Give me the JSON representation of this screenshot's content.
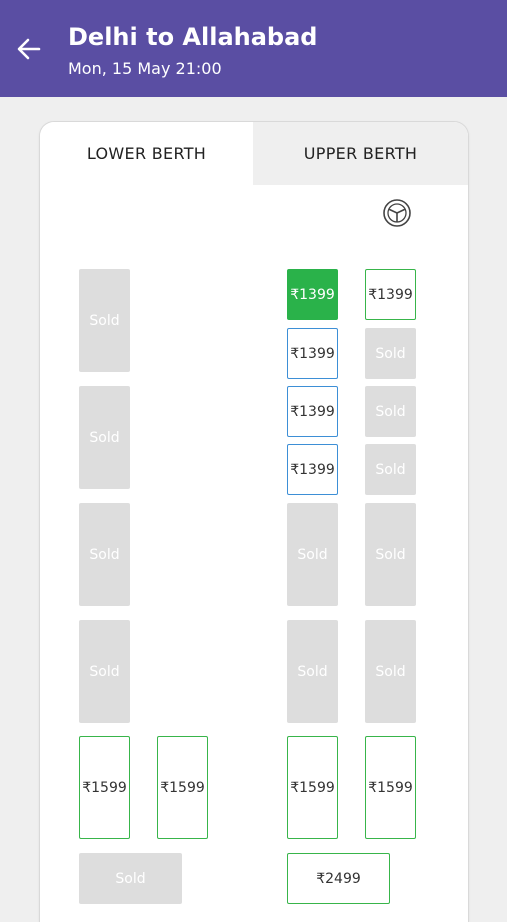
{
  "header": {
    "title": "Delhi to Allahabad",
    "subtitle": "Mon, 15 May 21:00"
  },
  "tabs": {
    "lower": "LOWER BERTH",
    "upper": "UPPER BERTH"
  },
  "colors": {
    "header_bg": "#5a4ea3",
    "selected": "#2ab24a",
    "available_blue": "#3d8fd6",
    "available_green": "#38b54a",
    "sold": "#dddddd"
  },
  "seats": {
    "sold_label": "Sold",
    "price_1399": "₹1399",
    "price_1599": "₹1599",
    "price_2499": "₹2499"
  }
}
